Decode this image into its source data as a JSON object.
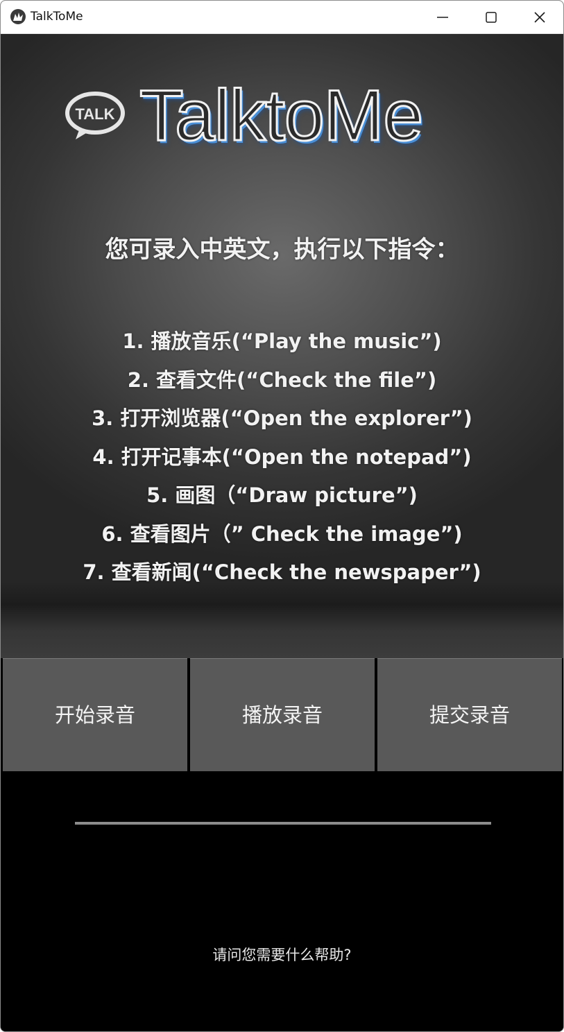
{
  "window": {
    "title": "TalkToMe",
    "icon": "kivy-app-icon",
    "controls": {
      "minimize_icon": "minimize-icon",
      "maximize_icon": "maximize-icon",
      "close_icon": "close-icon"
    }
  },
  "header": {
    "logo_badge": "TALK",
    "logo_title": "TalktoMe"
  },
  "instructions": {
    "intro": "您可录入中英文，执行以下指令：",
    "commands": [
      "1. 播放音乐(“Play the music”)",
      "2. 查看文件(“Check the file”)",
      "3. 打开浏览器(“Open the explorer”)",
      "4. 打开记事本(“Open the notepad”)",
      "5. 画图（“Draw picture”)",
      "6. 查看图片（” Check the image”)",
      "7. 查看新闻(“Check the newspaper”)"
    ]
  },
  "actions": {
    "start_label": "开始录音",
    "play_label": "播放录音",
    "submit_label": "提交录音"
  },
  "progress": {
    "value": 0
  },
  "status": {
    "text": "请问您需要什么帮助?"
  },
  "colors": {
    "button_bg": "#595959",
    "logo_accent": "#4a8fd6",
    "text": "#f2f2f2",
    "background": "#000000"
  }
}
